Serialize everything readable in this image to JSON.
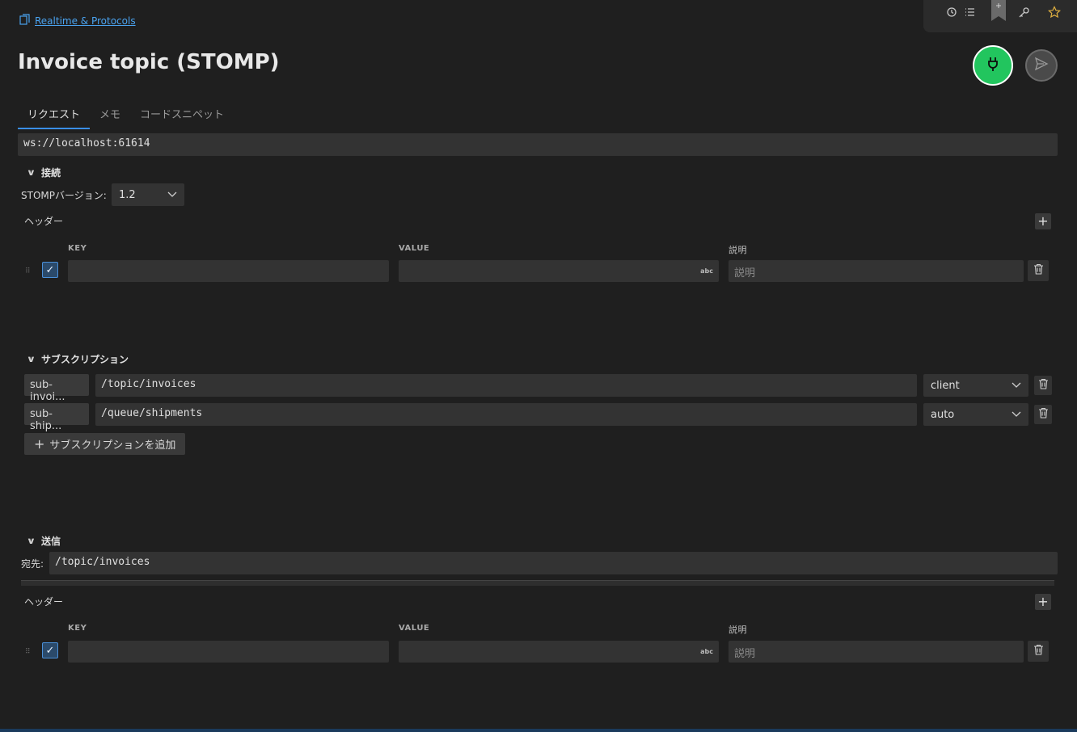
{
  "breadcrumb": {
    "label": "Realtime & Protocols"
  },
  "page": {
    "title": "Invoice topic (STOMP)"
  },
  "tabs": [
    {
      "label": "リクエスト",
      "active": true
    },
    {
      "label": "メモ",
      "active": false
    },
    {
      "label": "コードスニペット",
      "active": false
    }
  ],
  "url": {
    "value": "ws://localhost:61614"
  },
  "connection": {
    "section_label": "接続",
    "version_label": "STOMPバージョン:",
    "version_value": "1.2",
    "headers_label": "ヘッダー",
    "columns": {
      "key": "KEY",
      "value": "VALUE",
      "description": "説明"
    },
    "row": {
      "key": "",
      "value": "",
      "description_placeholder": "説明",
      "type_badge": "abc"
    }
  },
  "subscriptions": {
    "section_label": "サブスクリプション",
    "items": [
      {
        "name": "sub-invoi...",
        "destination": "/topic/invoices",
        "ack": "client"
      },
      {
        "name": "sub-ship...",
        "destination": "/queue/shipments",
        "ack": "auto"
      }
    ],
    "add_label": "サブスクリプションを追加"
  },
  "send": {
    "section_label": "送信",
    "destination_label": "宛先:",
    "destination_value": "/topic/invoices",
    "headers_label": "ヘッダー",
    "columns": {
      "key": "KEY",
      "value": "VALUE",
      "description": "説明"
    },
    "row": {
      "key": "",
      "value": "",
      "description_placeholder": "説明",
      "type_badge": "abc"
    }
  },
  "colors": {
    "accent": "#3a8ee6",
    "connect": "#22c55e",
    "background": "#1f1f1f",
    "field": "#333333"
  },
  "icons": [
    "history-icon",
    "list-icon",
    "bookmark-icon",
    "key-icon",
    "star-icon",
    "plug-icon",
    "send-icon",
    "trash-icon",
    "chevron-down-icon",
    "plus-icon",
    "check-icon"
  ]
}
